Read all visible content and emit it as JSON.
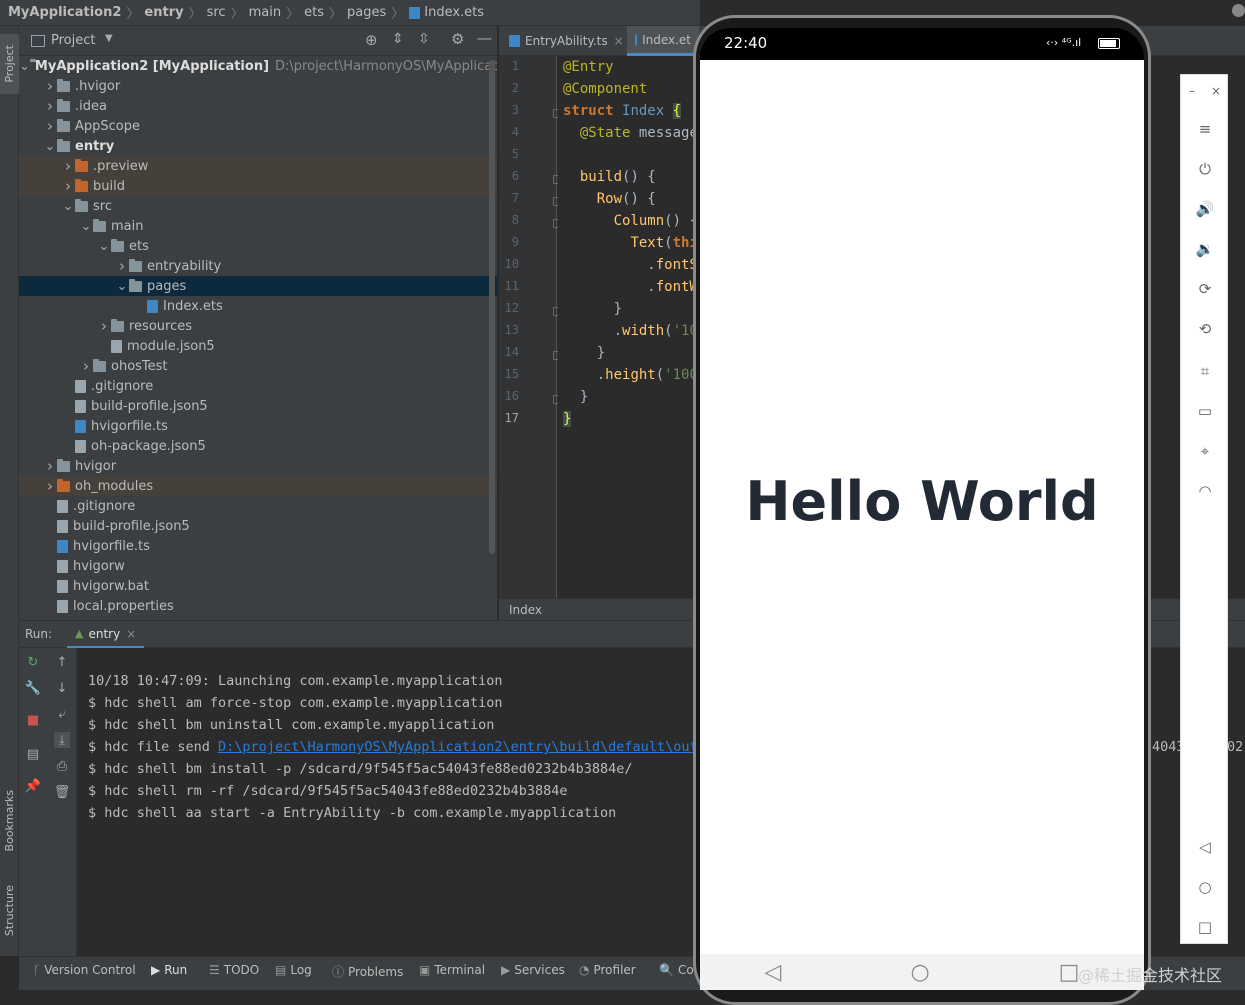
{
  "breadcrumb": [
    "MyApplication2",
    "entry",
    "src",
    "main",
    "ets",
    "pages",
    "Index.ets"
  ],
  "left_strip": {
    "project": "Project",
    "bookmarks": "Bookmarks",
    "structure": "Structure"
  },
  "project_panel": {
    "title": "Project",
    "tree": [
      {
        "label": "MyApplication2 [MyApplication]",
        "extra": "D:\\project\\HarmonyOS\\MyApplication",
        "depth": 0,
        "expanded": true,
        "type": "module",
        "bold": true
      },
      {
        "label": ".hvigor",
        "depth": 1,
        "type": "folder"
      },
      {
        "label": ".idea",
        "depth": 1,
        "type": "folder"
      },
      {
        "label": "AppScope",
        "depth": 1,
        "type": "folder"
      },
      {
        "label": "entry",
        "depth": 1,
        "expanded": true,
        "type": "module",
        "bold": true
      },
      {
        "label": ".preview",
        "depth": 2,
        "type": "folder-excluded",
        "excluded": true
      },
      {
        "label": "build",
        "depth": 2,
        "type": "folder-excluded",
        "excluded": true
      },
      {
        "label": "src",
        "depth": 2,
        "expanded": true,
        "type": "folder"
      },
      {
        "label": "main",
        "depth": 3,
        "expanded": true,
        "type": "folder"
      },
      {
        "label": "ets",
        "depth": 4,
        "expanded": true,
        "type": "folder"
      },
      {
        "label": "entryability",
        "depth": 5,
        "type": "folder"
      },
      {
        "label": "pages",
        "depth": 5,
        "expanded": true,
        "type": "folder",
        "selected": true
      },
      {
        "label": "Index.ets",
        "depth": 6,
        "type": "file-ts",
        "leaf": true
      },
      {
        "label": "resources",
        "depth": 4,
        "type": "folder"
      },
      {
        "label": "module.json5",
        "depth": 4,
        "type": "file",
        "leaf": true
      },
      {
        "label": "ohosTest",
        "depth": 3,
        "type": "folder"
      },
      {
        "label": ".gitignore",
        "depth": 2,
        "type": "file",
        "leaf": true
      },
      {
        "label": "build-profile.json5",
        "depth": 2,
        "type": "file",
        "leaf": true
      },
      {
        "label": "hvigorfile.ts",
        "depth": 2,
        "type": "file-ts",
        "leaf": true
      },
      {
        "label": "oh-package.json5",
        "depth": 2,
        "type": "file",
        "leaf": true
      },
      {
        "label": "hvigor",
        "depth": 1,
        "type": "folder"
      },
      {
        "label": "oh_modules",
        "depth": 1,
        "type": "folder-excluded",
        "excluded": true
      },
      {
        "label": ".gitignore",
        "depth": 1,
        "type": "file",
        "leaf": true
      },
      {
        "label": "build-profile.json5",
        "depth": 1,
        "type": "file",
        "leaf": true
      },
      {
        "label": "hvigorfile.ts",
        "depth": 1,
        "type": "file-ts",
        "leaf": true
      },
      {
        "label": "hvigorw",
        "depth": 1,
        "type": "file",
        "leaf": true
      },
      {
        "label": "hvigorw.bat",
        "depth": 1,
        "type": "file",
        "leaf": true
      },
      {
        "label": "local.properties",
        "depth": 1,
        "type": "file",
        "leaf": true
      }
    ]
  },
  "editor": {
    "tabs": [
      {
        "label": "EntryAbility.ts",
        "active": false
      },
      {
        "label": "Index.et",
        "active": true
      }
    ],
    "line_numbers": [
      "1",
      "2",
      "3",
      "4",
      "5",
      "6",
      "7",
      "8",
      "9",
      "10",
      "11",
      "12",
      "13",
      "14",
      "15",
      "16",
      "17"
    ],
    "footer": "Index"
  },
  "run_panel": {
    "label": "Run:",
    "tab": "entry",
    "lines": [
      "10/18 10:47:09: Launching com.example.myapplication",
      "$ hdc shell am force-stop com.example.myapplication",
      "$ hdc shell bm uninstall com.example.myapplication",
      "$ hdc shell bm install -p /sdcard/9f545f5ac54043fe88ed0232b4b3884e/",
      "$ hdc shell rm -rf /sdcard/9f545f5ac54043fe88ed0232b4b3884e",
      "$ hdc shell aa start -a EntryAbility -b com.example.myapplication"
    ],
    "file_send_prefix": "$ hdc file send ",
    "file_send_link": "D:\\project\\HarmonyOS\\MyApplication2\\entry\\build\\default\\outp",
    "file_send_tail1": "4043",
    "file_send_tail2": "02"
  },
  "status_bar": [
    "Version Control",
    "Run",
    "TODO",
    "Log",
    "Problems",
    "Terminal",
    "Services",
    "Profiler",
    "Coc"
  ],
  "phone": {
    "time": "22:40",
    "content": "Hello World"
  },
  "watermark": "@稀土掘金技术社区",
  "colors": {
    "accent": "#4a88c7",
    "link": "#287bde",
    "excluded_folder": "#c2662f"
  }
}
